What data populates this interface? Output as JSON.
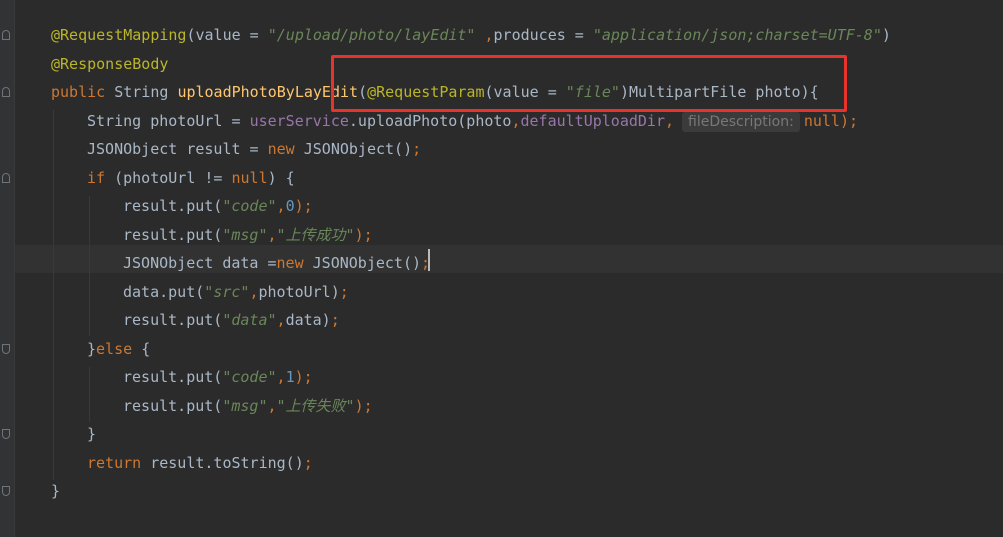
{
  "editor": {
    "theme_colors": {
      "background": "#2b2b2b",
      "annotation": "#bbb529",
      "keyword": "#cc7832",
      "string": "#6a8759",
      "method": "#ffc66d",
      "field": "#9876aa",
      "number": "#6897bb",
      "text": "#a9b7c6",
      "highlight_box": "#e8332c"
    },
    "lines": {
      "l1": {
        "a1": "@RequestMapping",
        "a2": "(value = ",
        "a3": "\"/upload/photo/layEdit\"",
        "a4": " ,",
        "a5": "produces = ",
        "a6": "\"application/json;charset=UTF-8\"",
        "a7": ")"
      },
      "l2": {
        "a1": "@ResponseBody"
      },
      "l3": {
        "a1": "public ",
        "a2": "String ",
        "a3": "uploadPhotoByLayEdit",
        "a4": "(",
        "a5": "@RequestParam",
        "a6": "(value = ",
        "a7": "\"file\"",
        "a8": ")MultipartFile photo){"
      },
      "l4": {
        "a1": "String photoUrl = ",
        "a2": "userService",
        "a3": ".uploadPhoto(photo",
        "a4": ",",
        "a5": "defaultUploadDir",
        "a6": ",",
        "hint": "fileDescription:",
        "a7": "null",
        "a8": ");"
      },
      "l5": {
        "a1": "JSONObject result = ",
        "a2": "new ",
        "a3": "JSONObject()",
        "a4": ";"
      },
      "l6": {
        "a1": "if ",
        "a2": "(photoUrl != ",
        "a3": "null",
        "a4": ") {"
      },
      "l7": {
        "a1": "result.put(",
        "a2": "\"code\"",
        "a3": ",",
        "a4": "0",
        "a5": ");"
      },
      "l8": {
        "a1": "result.put(",
        "a2": "\"msg\"",
        "a3": ",",
        "a4": "\"上传成功\"",
        "a5": ");"
      },
      "l9": {
        "a1": "JSONObject data =",
        "a2": "new ",
        "a3": "JSONObject()",
        "a4": ";"
      },
      "l10": {
        "a1": "data.put(",
        "a2": "\"src\"",
        "a3": ",",
        "a4": "photoUrl)",
        "a5": ";"
      },
      "l11": {
        "a1": "result.put(",
        "a2": "\"data\"",
        "a3": ",",
        "a4": "data)",
        "a5": ";"
      },
      "l12": {
        "a1": "}",
        "a2": "else ",
        "a3": "{"
      },
      "l13": {
        "a1": "result.put(",
        "a2": "\"code\"",
        "a3": ",",
        "a4": "1",
        "a5": ");"
      },
      "l14": {
        "a1": "result.put(",
        "a2": "\"msg\"",
        "a3": ",",
        "a4": "\"上传失败\"",
        "a5": ");"
      },
      "l15": {
        "a1": "}"
      },
      "l16": {
        "a1": "return ",
        "a2": "result.toString()",
        "a3": ";"
      },
      "l17": {
        "a1": "}"
      }
    }
  }
}
